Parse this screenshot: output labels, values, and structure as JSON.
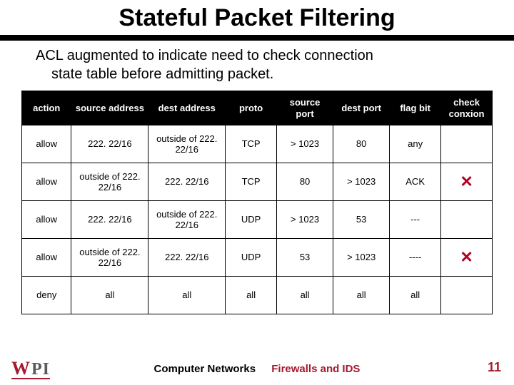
{
  "title": "Stateful Packet Filtering",
  "subtitle_line1": "ACL augmented to indicate need to check connection",
  "subtitle_line2": "state table before admitting packet.",
  "headers": {
    "action": "action",
    "source_address": "source address",
    "dest_address": "dest address",
    "proto": "proto",
    "source_port": "source port",
    "dest_port": "dest port",
    "flag_bit": "flag bit",
    "check_conxion": "check conxion"
  },
  "rows": [
    {
      "action": "allow",
      "saddr": "222. 22/16",
      "daddr": "outside of 222. 22/16",
      "proto": "TCP",
      "sport": "> 1023",
      "dport": "80",
      "flag": "any",
      "check": ""
    },
    {
      "action": "allow",
      "saddr": "outside of 222. 22/16",
      "daddr": "222. 22/16",
      "proto": "TCP",
      "sport": "80",
      "dport": "> 1023",
      "flag": "ACK",
      "check": "x"
    },
    {
      "action": "allow",
      "saddr": "222. 22/16",
      "daddr": "outside of 222. 22/16",
      "proto": "UDP",
      "sport": "> 1023",
      "dport": "53",
      "flag": "---",
      "check": ""
    },
    {
      "action": "allow",
      "saddr": "outside of 222. 22/16",
      "daddr": "222. 22/16",
      "proto": "UDP",
      "sport": "53",
      "dport": "> 1023",
      "flag": "----",
      "check": "x"
    },
    {
      "action": "deny",
      "saddr": "all",
      "daddr": "all",
      "proto": "all",
      "sport": "all",
      "dport": "all",
      "flag": "all",
      "check": ""
    }
  ],
  "footer": {
    "course": "Computer Networks",
    "topic": "Firewalls and IDS",
    "page": "11",
    "logo_w": "W",
    "logo_pi": "PI"
  },
  "chart_data": {
    "type": "table",
    "title": "Stateful Packet Filtering ACL",
    "columns": [
      "action",
      "source address",
      "dest address",
      "proto",
      "source port",
      "dest port",
      "flag bit",
      "check conxion"
    ],
    "rows": [
      [
        "allow",
        "222.22/16",
        "outside of 222.22/16",
        "TCP",
        "> 1023",
        "80",
        "any",
        ""
      ],
      [
        "allow",
        "outside of 222.22/16",
        "222.22/16",
        "TCP",
        "80",
        "> 1023",
        "ACK",
        "x"
      ],
      [
        "allow",
        "222.22/16",
        "outside of 222.22/16",
        "UDP",
        "> 1023",
        "53",
        "---",
        ""
      ],
      [
        "allow",
        "outside of 222.22/16",
        "222.22/16",
        "UDP",
        "53",
        "> 1023",
        "----",
        "x"
      ],
      [
        "deny",
        "all",
        "all",
        "all",
        "all",
        "all",
        "all",
        ""
      ]
    ]
  }
}
